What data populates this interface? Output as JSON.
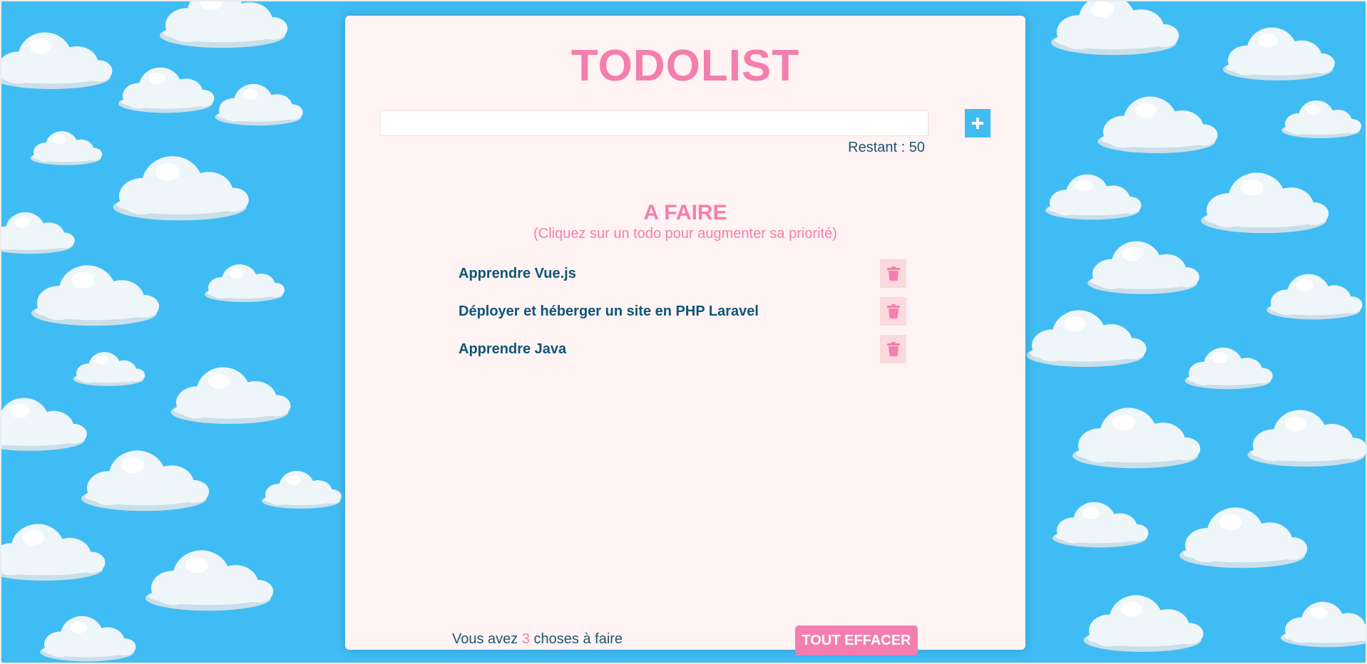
{
  "app": {
    "title": "TODOLIST"
  },
  "input": {
    "value": "",
    "placeholder": "",
    "add_icon": "plus-icon",
    "remaining_label": "Restant : 50"
  },
  "section": {
    "title": "A FAIRE",
    "subtitle": "(Cliquez sur un todo pour augmenter sa priorité)"
  },
  "todos": [
    {
      "label": "Apprendre Vue.js",
      "delete_icon": "trash-icon"
    },
    {
      "label": "Déployer et héberger un site en PHP Laravel",
      "delete_icon": "trash-icon"
    },
    {
      "label": "Apprendre Java",
      "delete_icon": "trash-icon"
    }
  ],
  "footer": {
    "prefix": "Vous avez",
    "count": "3",
    "suffix": "choses à faire",
    "clear_label": "TOUT EFFACER"
  },
  "colors": {
    "accent_pink": "#f47ead",
    "sky_blue": "#40bcf4",
    "panel_bg": "#fff3f3",
    "text_navy": "#0f5577",
    "trash_bg": "#fadadd"
  }
}
